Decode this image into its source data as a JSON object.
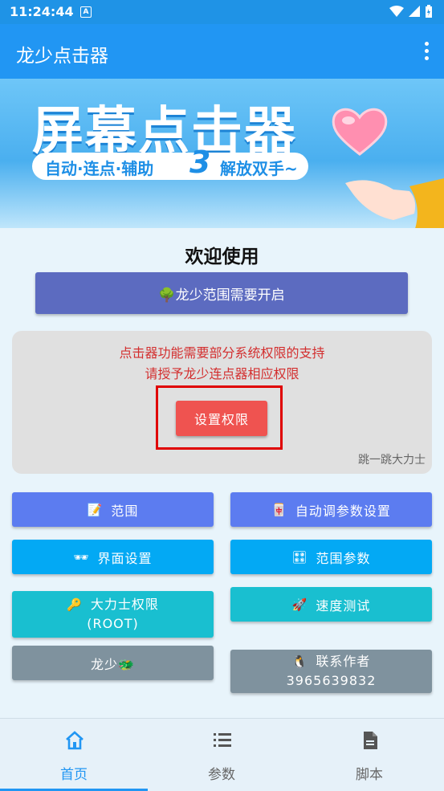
{
  "status": {
    "time": "11:24:44",
    "badge": "A"
  },
  "app": {
    "title": "龙少点击器"
  },
  "banner": {
    "title": "屏幕点击器",
    "tag_left": "自动·连点·辅助",
    "tag_num": "3",
    "tag_right": "解放双手~"
  },
  "main": {
    "welcome": "欢迎使用",
    "range_button": "🌳龙少范围需要开启",
    "permission": {
      "line1": "点击器功能需要部分系统权限的支持",
      "line2": "请授予龙少连点器相应权限",
      "button": "设置权限",
      "note": "跳一跳大力士"
    },
    "buttons": {
      "range": {
        "icon": "📝",
        "label": "范围"
      },
      "auto_params": {
        "icon": "🀄",
        "label": "自动调参数设置"
      },
      "ui_settings": {
        "icon": "🕶",
        "label": "界面设置"
      },
      "range_params": {
        "icon": "🎛",
        "label": "范围参数"
      },
      "root": {
        "icon": "🔑",
        "label": "大力士权限",
        "sub": "(ROOT)"
      },
      "speed_test": {
        "icon": "🚀",
        "label": "速度测试"
      },
      "longshao": {
        "label": "龙少🐲"
      },
      "contact": {
        "icon": "🐧",
        "label": "联系作者",
        "sub": "3965639832"
      }
    }
  },
  "nav": {
    "items": [
      "首页",
      "参数",
      "脚本"
    ],
    "active": 0
  },
  "colors": {
    "accent": "#2196f3",
    "warning": "#d32f2f"
  }
}
